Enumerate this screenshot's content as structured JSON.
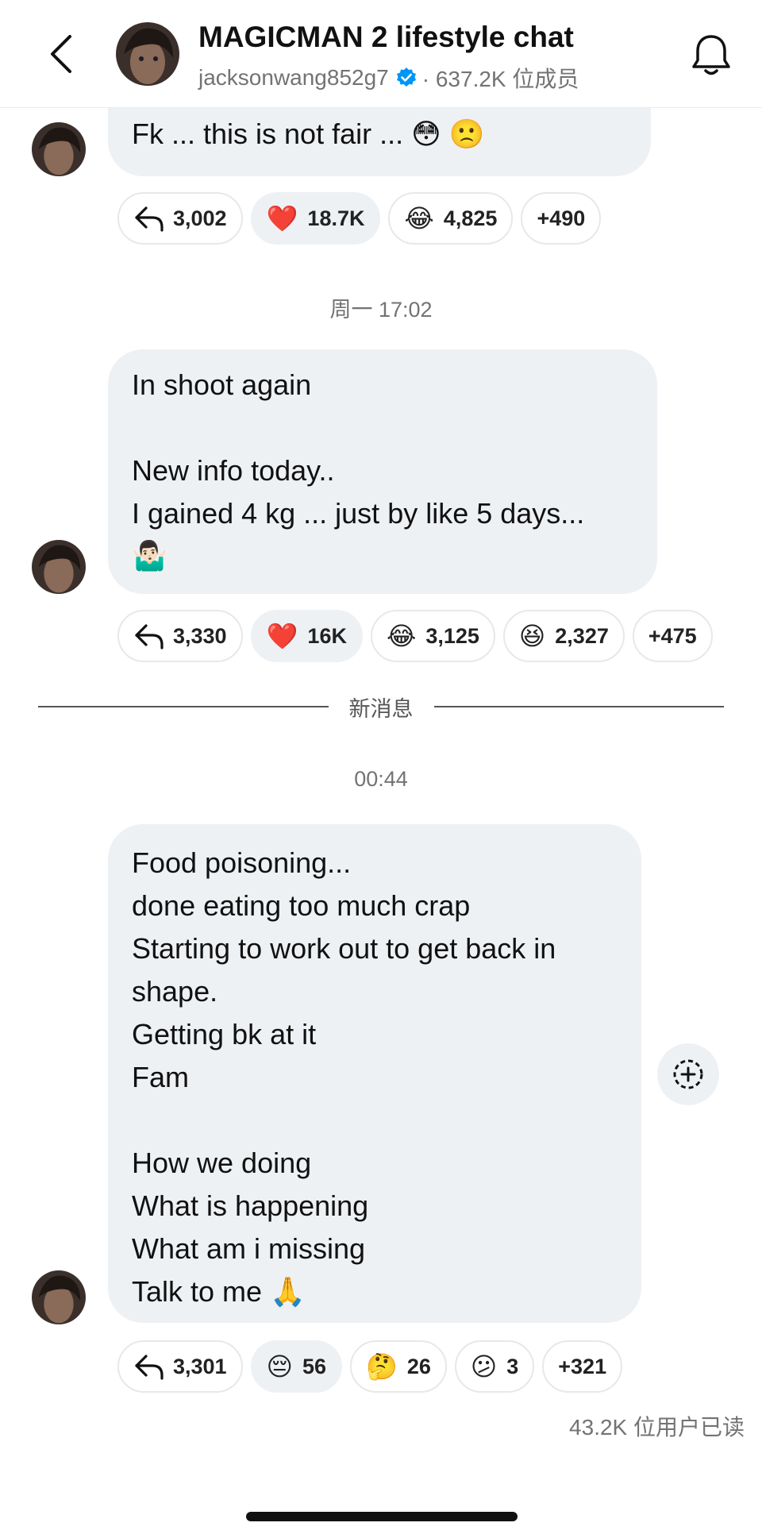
{
  "header": {
    "title": "MAGICMAN 2 lifestyle chat",
    "username": "jacksonwang852g7",
    "members": "· 637.2K 位成员"
  },
  "colors": {
    "bubble_bg": "#eef1f4",
    "verified_blue": "#0095f6",
    "muted_text": "#737373"
  },
  "messages": [
    {
      "lines": [
        "Fk ... this is not fair ... 😳 🙁"
      ],
      "reply_count": "3,002",
      "reactions": [
        {
          "emoji": "❤️",
          "count": "18.7K"
        },
        {
          "emoji": "😂",
          "count": "4,825"
        }
      ],
      "more": "+490"
    },
    {
      "timestamp": "周一 17:02",
      "lines": [
        "In shoot again",
        "",
        "New info today..",
        "I gained 4 kg ... just by like 5 days...",
        "🤷🏻‍♂️"
      ],
      "reply_count": "3,330",
      "reactions": [
        {
          "emoji": "❤️",
          "count": "16K"
        },
        {
          "emoji": "😂",
          "count": "3,125"
        },
        {
          "emoji": "😆",
          "count": "2,327"
        }
      ],
      "more": "+475"
    },
    {
      "timestamp": "00:44",
      "lines": [
        "Food poisoning...",
        "done eating too much crap",
        "Starting to work out to get back in",
        "shape.",
        "Getting bk at it",
        "Fam",
        "",
        "How we doing",
        "What is happening",
        "What am i missing",
        "Talk to me 🙏"
      ],
      "reply_count": "3,301",
      "reactions": [
        {
          "emoji": "😔",
          "count": "56"
        },
        {
          "emoji": "🤔",
          "count": "26"
        },
        {
          "emoji": "😕",
          "count": "3"
        }
      ],
      "more": "+321"
    }
  ],
  "divider_label": "新消息",
  "seen_text": "43.2K 位用户已读"
}
